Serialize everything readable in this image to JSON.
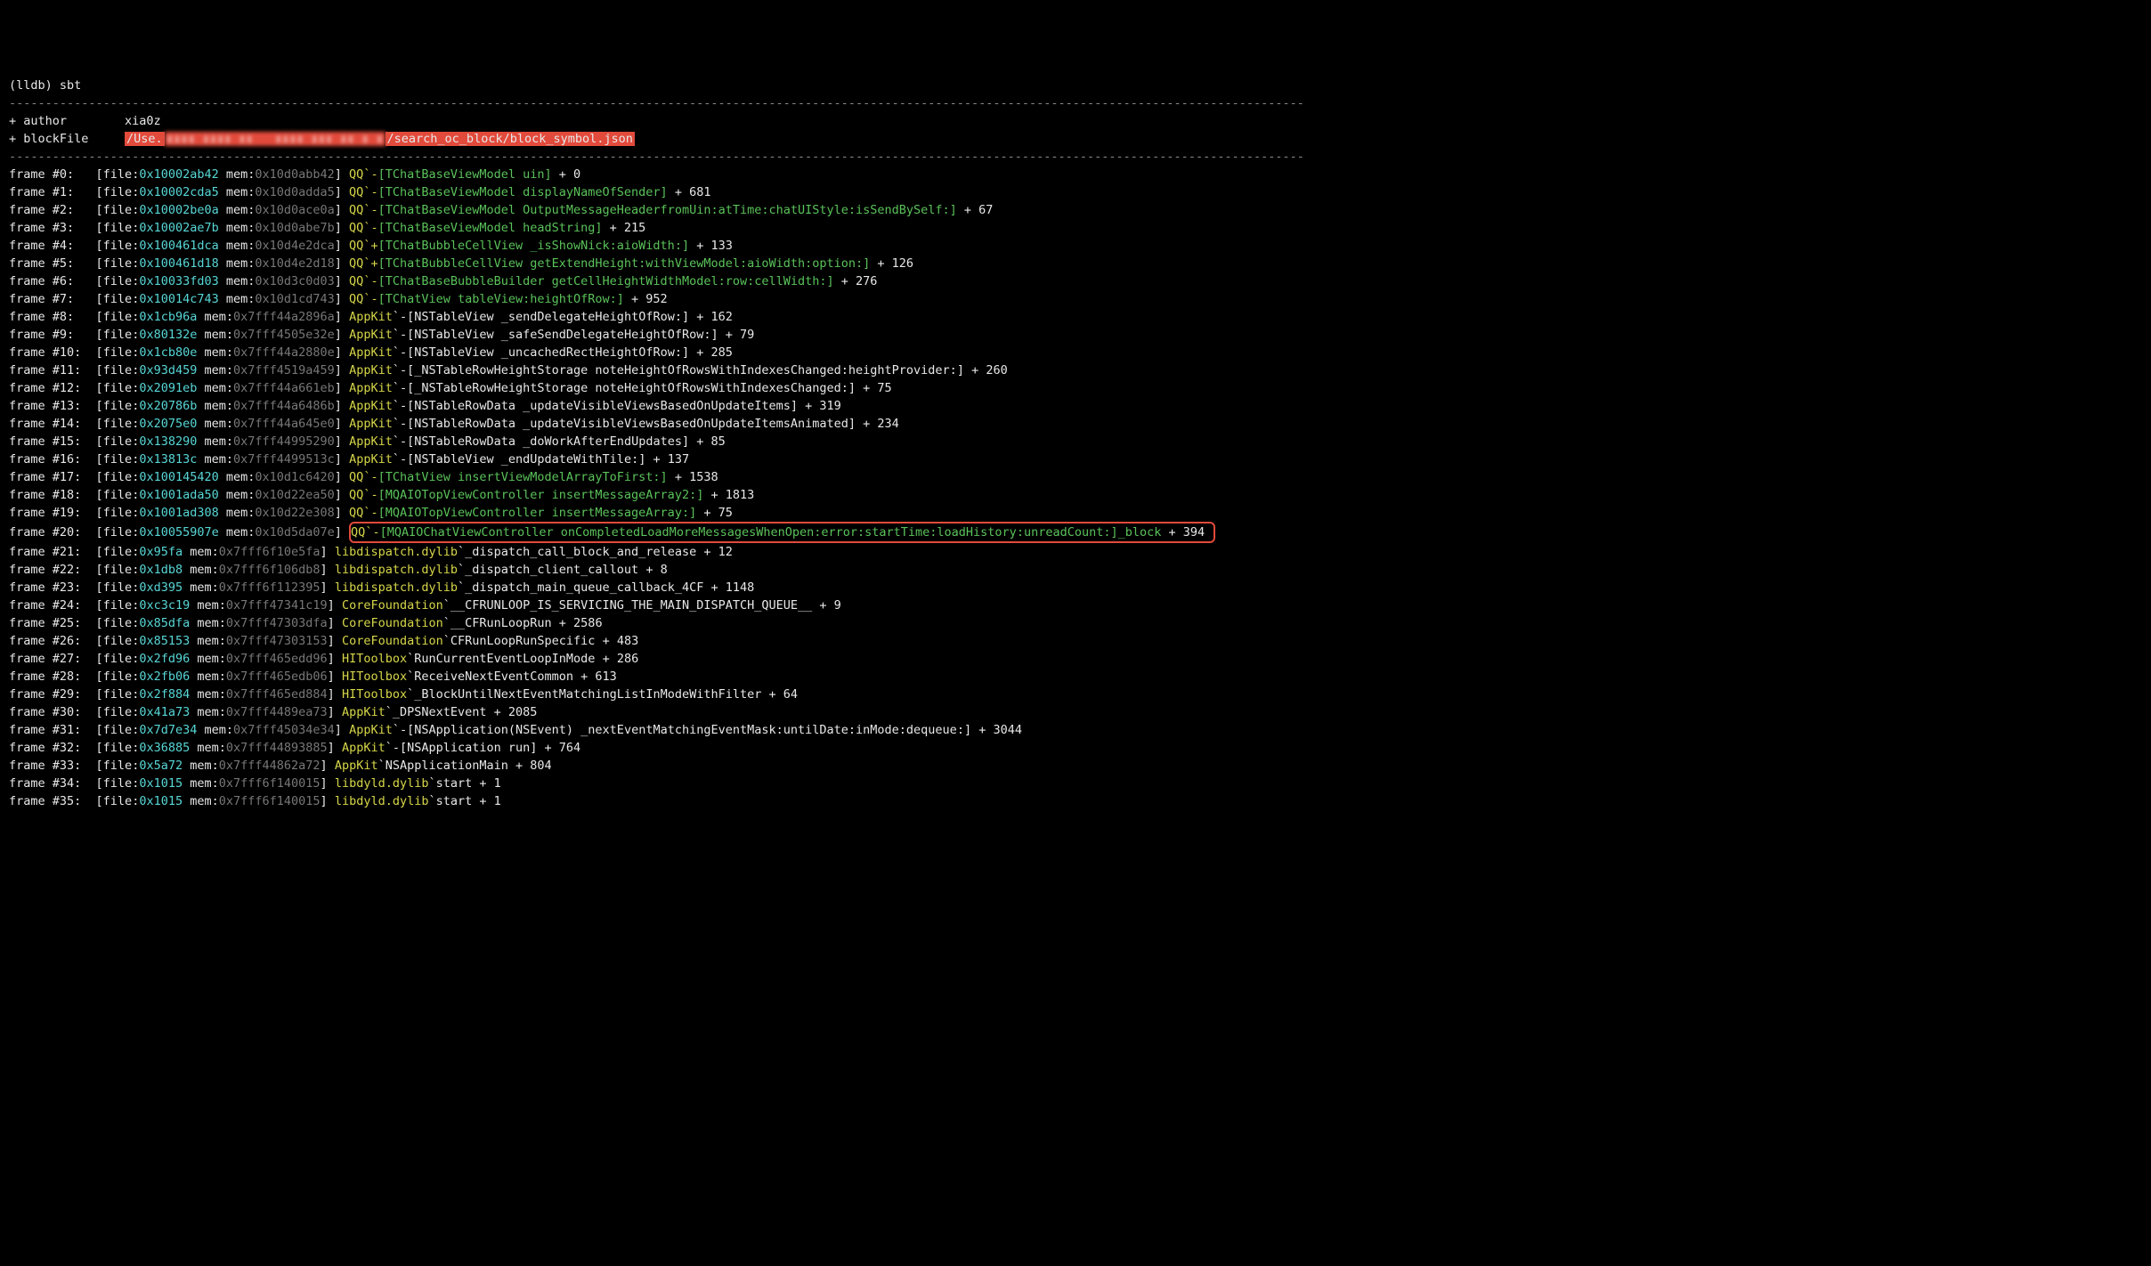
{
  "prompt": "(lldb) ",
  "command": "sbt",
  "author_label": "+ author",
  "author_value": "xia0z",
  "blockfile_label": "+ blockFile",
  "blockfile_prefix": "/Use.",
  "blockfile_blur": "▮▮▮▮ ▮▮▮▮ ▮▮   ▮▮▮▮ ▮▮▮ ▮▮ ▮ ▮",
  "blockfile_suffix": "/search_oc_block/block_symbol.json",
  "hr": "-----------------------------------------------------------------------------------------------------------------------------------------------------------------------------------",
  "frames": [
    {
      "n": "#0",
      "file": "0x10002ab42",
      "mem": "0x10d0abb42",
      "mod": "QQ",
      "sep": "`-",
      "sym": "[TChatBaseViewModel uin]",
      "off": "+ 0",
      "hl": false
    },
    {
      "n": "#1",
      "file": "0x10002cda5",
      "mem": "0x10d0adda5",
      "mod": "QQ",
      "sep": "`-",
      "sym": "[TChatBaseViewModel displayNameOfSender]",
      "off": "+ 681",
      "hl": false
    },
    {
      "n": "#2",
      "file": "0x10002be0a",
      "mem": "0x10d0ace0a",
      "mod": "QQ",
      "sep": "`-",
      "sym": "[TChatBaseViewModel OutputMessageHeaderfromUin:atTime:chatUIStyle:isSendBySelf:]",
      "off": "+ 67",
      "hl": false
    },
    {
      "n": "#3",
      "file": "0x10002ae7b",
      "mem": "0x10d0abe7b",
      "mod": "QQ",
      "sep": "`-",
      "sym": "[TChatBaseViewModel headString]",
      "off": "+ 215",
      "hl": false
    },
    {
      "n": "#4",
      "file": "0x100461dca",
      "mem": "0x10d4e2dca",
      "mod": "QQ",
      "sep": "`+",
      "sym": "[TChatBubbleCellView _isShowNick:aioWidth:]",
      "off": "+ 133",
      "hl": false
    },
    {
      "n": "#5",
      "file": "0x100461d18",
      "mem": "0x10d4e2d18",
      "mod": "QQ",
      "sep": "`+",
      "sym": "[TChatBubbleCellView getExtendHeight:withViewModel:aioWidth:option:]",
      "off": "+ 126",
      "hl": false
    },
    {
      "n": "#6",
      "file": "0x10033fd03",
      "mem": "0x10d3c0d03",
      "mod": "QQ",
      "sep": "`-",
      "sym": "[TChatBaseBubbleBuilder getCellHeightWidthModel:row:cellWidth:]",
      "off": "+ 276",
      "hl": false
    },
    {
      "n": "#7",
      "file": "0x10014c743",
      "mem": "0x10d1cd743",
      "mod": "QQ",
      "sep": "`-",
      "sym": "[TChatView tableView:heightOfRow:]",
      "off": "+ 952",
      "hl": false
    },
    {
      "n": "#8",
      "file": "0x1cb96a",
      "mem": "0x7fff44a2896a",
      "mod": "AppKit",
      "sep": "`-",
      "sym": "[NSTableView _sendDelegateHeightOfRow:]",
      "off": "+ 162",
      "hl": false,
      "plain": true
    },
    {
      "n": "#9",
      "file": "0x80132e",
      "mem": "0x7fff4505e32e",
      "mod": "AppKit",
      "sep": "`-",
      "sym": "[NSTableView _safeSendDelegateHeightOfRow:]",
      "off": "+ 79",
      "hl": false,
      "plain": true
    },
    {
      "n": "#10",
      "file": "0x1cb80e",
      "mem": "0x7fff44a2880e",
      "mod": "AppKit",
      "sep": "`-",
      "sym": "[NSTableView _uncachedRectHeightOfRow:]",
      "off": "+ 285",
      "hl": false,
      "plain": true
    },
    {
      "n": "#11",
      "file": "0x93d459",
      "mem": "0x7fff4519a459",
      "mod": "AppKit",
      "sep": "`-",
      "sym": "[_NSTableRowHeightStorage noteHeightOfRowsWithIndexesChanged:heightProvider:]",
      "off": "+ 260",
      "hl": false,
      "plain": true
    },
    {
      "n": "#12",
      "file": "0x2091eb",
      "mem": "0x7fff44a661eb",
      "mod": "AppKit",
      "sep": "`-",
      "sym": "[_NSTableRowHeightStorage noteHeightOfRowsWithIndexesChanged:]",
      "off": "+ 75",
      "hl": false,
      "plain": true
    },
    {
      "n": "#13",
      "file": "0x20786b",
      "mem": "0x7fff44a6486b",
      "mod": "AppKit",
      "sep": "`-",
      "sym": "[NSTableRowData _updateVisibleViewsBasedOnUpdateItems]",
      "off": "+ 319",
      "hl": false,
      "plain": true
    },
    {
      "n": "#14",
      "file": "0x2075e0",
      "mem": "0x7fff44a645e0",
      "mod": "AppKit",
      "sep": "`-",
      "sym": "[NSTableRowData _updateVisibleViewsBasedOnUpdateItemsAnimated]",
      "off": "+ 234",
      "hl": false,
      "plain": true
    },
    {
      "n": "#15",
      "file": "0x138290",
      "mem": "0x7fff44995290",
      "mod": "AppKit",
      "sep": "`-",
      "sym": "[NSTableRowData _doWorkAfterEndUpdates]",
      "off": "+ 85",
      "hl": false,
      "plain": true
    },
    {
      "n": "#16",
      "file": "0x13813c",
      "mem": "0x7fff4499513c",
      "mod": "AppKit",
      "sep": "`-",
      "sym": "[NSTableView _endUpdateWithTile:]",
      "off": "+ 137",
      "hl": false,
      "plain": true
    },
    {
      "n": "#17",
      "file": "0x100145420",
      "mem": "0x10d1c6420",
      "mod": "QQ",
      "sep": "`-",
      "sym": "[TChatView insertViewModelArrayToFirst:]",
      "off": "+ 1538",
      "hl": false
    },
    {
      "n": "#18",
      "file": "0x1001ada50",
      "mem": "0x10d22ea50",
      "mod": "QQ",
      "sep": "`-",
      "sym": "[MQAIOTopViewController insertMessageArray2:]",
      "off": "+ 1813",
      "hl": false
    },
    {
      "n": "#19",
      "file": "0x1001ad308",
      "mem": "0x10d22e308",
      "mod": "QQ",
      "sep": "`-",
      "sym": "[MQAIOTopViewController insertMessageArray:]",
      "off": "+ 75",
      "hl": false
    },
    {
      "n": "#20",
      "file": "0x10055907e",
      "mem": "0x10d5da07e",
      "mod": "QQ",
      "sep": "`-",
      "sym": "[MQAIOChatViewController onCompletedLoadMoreMessagesWhenOpen:error:startTime:loadHistory:unreadCount:]_block",
      "off": "+ 394",
      "hl": true
    },
    {
      "n": "#21",
      "file": "0x95fa",
      "mem": "0x7fff6f10e5fa",
      "mod": "libdispatch.dylib",
      "sep": "`",
      "sym": "_dispatch_call_block_and_release",
      "off": "+ 12",
      "hl": false,
      "plain": true
    },
    {
      "n": "#22",
      "file": "0x1db8",
      "mem": "0x7fff6f106db8",
      "mod": "libdispatch.dylib",
      "sep": "`",
      "sym": "_dispatch_client_callout",
      "off": "+ 8",
      "hl": false,
      "plain": true
    },
    {
      "n": "#23",
      "file": "0xd395",
      "mem": "0x7fff6f112395",
      "mod": "libdispatch.dylib",
      "sep": "`",
      "sym": "_dispatch_main_queue_callback_4CF",
      "off": "+ 1148",
      "hl": false,
      "plain": true
    },
    {
      "n": "#24",
      "file": "0xc3c19",
      "mem": "0x7fff47341c19",
      "mod": "CoreFoundation",
      "sep": "`",
      "sym": "__CFRUNLOOP_IS_SERVICING_THE_MAIN_DISPATCH_QUEUE__",
      "off": "+ 9",
      "hl": false,
      "plain": true
    },
    {
      "n": "#25",
      "file": "0x85dfa",
      "mem": "0x7fff47303dfa",
      "mod": "CoreFoundation",
      "sep": "`",
      "sym": "__CFRunLoopRun",
      "off": "+ 2586",
      "hl": false,
      "plain": true
    },
    {
      "n": "#26",
      "file": "0x85153",
      "mem": "0x7fff47303153",
      "mod": "CoreFoundation",
      "sep": "`",
      "sym": "CFRunLoopRunSpecific",
      "off": "+ 483",
      "hl": false,
      "plain": true
    },
    {
      "n": "#27",
      "file": "0x2fd96",
      "mem": "0x7fff465edd96",
      "mod": "HIToolbox",
      "sep": "`",
      "sym": "RunCurrentEventLoopInMode",
      "off": "+ 286",
      "hl": false,
      "plain": true
    },
    {
      "n": "#28",
      "file": "0x2fb06",
      "mem": "0x7fff465edb06",
      "mod": "HIToolbox",
      "sep": "`",
      "sym": "ReceiveNextEventCommon",
      "off": "+ 613",
      "hl": false,
      "plain": true
    },
    {
      "n": "#29",
      "file": "0x2f884",
      "mem": "0x7fff465ed884",
      "mod": "HIToolbox",
      "sep": "`",
      "sym": "_BlockUntilNextEventMatchingListInModeWithFilter",
      "off": "+ 64",
      "hl": false,
      "plain": true
    },
    {
      "n": "#30",
      "file": "0x41a73",
      "mem": "0x7fff4489ea73",
      "mod": "AppKit",
      "sep": "`",
      "sym": "_DPSNextEvent",
      "off": "+ 2085",
      "hl": false,
      "plain": true
    },
    {
      "n": "#31",
      "file": "0x7d7e34",
      "mem": "0x7fff45034e34",
      "mod": "AppKit",
      "sep": "`-",
      "sym": "[NSApplication(NSEvent) _nextEventMatchingEventMask:untilDate:inMode:dequeue:]",
      "off": "+ 3044",
      "hl": false,
      "plain": true
    },
    {
      "n": "#32",
      "file": "0x36885",
      "mem": "0x7fff44893885",
      "mod": "AppKit",
      "sep": "`-",
      "sym": "[NSApplication run]",
      "off": "+ 764",
      "hl": false,
      "plain": true
    },
    {
      "n": "#33",
      "file": "0x5a72",
      "mem": "0x7fff44862a72",
      "mod": "AppKit",
      "sep": "`",
      "sym": "NSApplicationMain",
      "off": "+ 804",
      "hl": false,
      "plain": true
    },
    {
      "n": "#34",
      "file": "0x1015",
      "mem": "0x7fff6f140015",
      "mod": "libdyld.dylib",
      "sep": "`",
      "sym": "start",
      "off": "+ 1",
      "hl": false,
      "plain": true
    },
    {
      "n": "#35",
      "file": "0x1015",
      "mem": "0x7fff6f140015",
      "mod": "libdyld.dylib",
      "sep": "`",
      "sym": "start",
      "off": "+ 1",
      "hl": false,
      "plain": true
    }
  ]
}
